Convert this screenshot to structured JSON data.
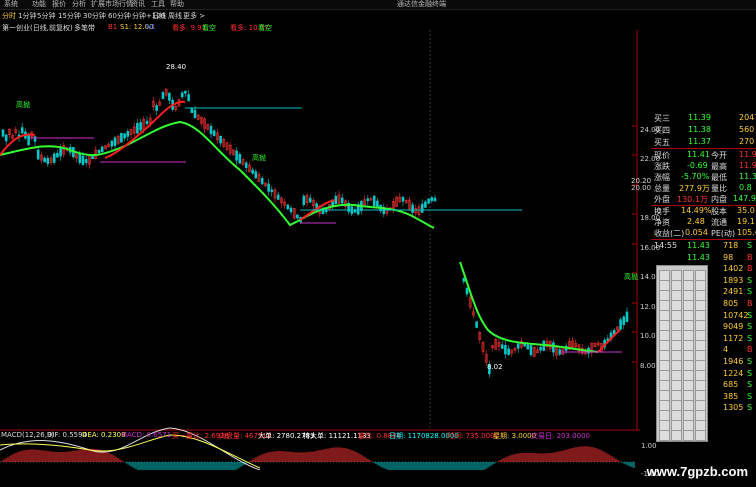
{
  "menubar": {
    "items": [
      "系统",
      "功能",
      "报价",
      "分析",
      "扩展市场行情",
      "资讯",
      "工具",
      "帮助"
    ],
    "right_title": "通达信金融终端"
  },
  "toolbar": {
    "tabs": [
      "分时",
      "1分钟",
      "5分钟",
      "15分钟",
      "30分钟",
      "60分钟",
      "分钟+120",
      "日线",
      "周线",
      "更多 >"
    ],
    "active_index": 0
  },
  "infobar": {
    "name": "第一创业(日线,前复权)",
    "indicator": "多笔带",
    "b1": "B1",
    "s1": "S1: 12.00",
    "n1": "N1",
    "sell1": "看多: 9.91",
    "sell2": "看空",
    "sell3": "看多: 10.77",
    "sell4": "看空"
  },
  "y_axis_main": [
    "24.00",
    "22.00",
    "20.00",
    "18.00",
    "16.00",
    "14.00",
    "12.00",
    "10.00",
    "8.00"
  ],
  "y_axis_extra": "20.20",
  "annotations": {
    "high": "28.40",
    "low": "8.02",
    "cross1": "高抛",
    "cross2": "高抛",
    "cross3": "高抛"
  },
  "macd": {
    "title": "MACD(12,26,9)",
    "dif": "DIF: 0.5594",
    "dea": "DEA: 0.2308",
    "macd": "MACD: 0.6571",
    "hui1": "买一量比: 2.6926",
    "hui2": "内盘量: 467913",
    "hui3": "大单: 2780.2783",
    "hui4": "特大单: 11121.1133",
    "hui5": "量比: 0.8884",
    "hui6": "日期: 1170828.0000",
    "hui7": "时间: 735.0000",
    "hui8": "星期: 3.0000",
    "hui9": "交易日: 203.0000",
    "y_top": "1.00",
    "y_bottom": "-1.00"
  },
  "panel": {
    "rows": [
      {
        "label": "买三",
        "value": "11.39",
        "vol": "2047"
      },
      {
        "label": "买四",
        "value": "11.38",
        "vol": "560"
      },
      {
        "label": "买五",
        "value": "11.37",
        "vol": "270"
      }
    ],
    "quote": [
      {
        "l1": "现价",
        "v1": "11.41",
        "l2": "今开",
        "v2": "11.9"
      },
      {
        "l1": "涨跌",
        "v1": "-0.69",
        "l2": "最高",
        "v2": "11.9"
      },
      {
        "l1": "涨幅",
        "v1": "-5.70%",
        "l2": "最低",
        "v2": "11.3"
      },
      {
        "l1": "总量",
        "v1": "277.9万",
        "l2": "量比",
        "v2": "0.8"
      },
      {
        "l1": "外盘",
        "v1": "130.1万",
        "l2": "内盘",
        "v2": "147.9"
      }
    ],
    "stats": [
      {
        "l1": "换手",
        "v1": "14.49%",
        "l2": "股本",
        "v2": "35.0"
      },
      {
        "l1": "净资",
        "v1": "2.48",
        "l2": "流通",
        "v2": "19.1"
      },
      {
        "l1": "收益(二)",
        "v1": "0.054",
        "l2": "PE(动)",
        "v2": "105.6"
      }
    ],
    "ticks": [
      {
        "t": "14:55",
        "p": "11.43",
        "v": "718",
        "s": "S"
      },
      {
        "t": "",
        "p": "11.43",
        "v": "98",
        "s": "B"
      },
      {
        "t": "",
        "p": "",
        "v": "1402",
        "s": "B"
      },
      {
        "t": "",
        "p": "",
        "v": "1893",
        "s": "S"
      },
      {
        "t": "",
        "p": "",
        "v": "2491",
        "s": "S"
      },
      {
        "t": "",
        "p": "",
        "v": "805",
        "s": "B"
      },
      {
        "t": "",
        "p": "",
        "v": "10742",
        "s": "S"
      },
      {
        "t": "",
        "p": "",
        "v": "9049",
        "s": "S"
      },
      {
        "t": "",
        "p": "",
        "v": "1172",
        "s": "S"
      },
      {
        "t": "",
        "p": "",
        "v": "4",
        "s": "B"
      },
      {
        "t": "",
        "p": "",
        "v": "1946",
        "s": "S"
      },
      {
        "t": "",
        "p": "",
        "v": "1224",
        "s": "S"
      },
      {
        "t": "",
        "p": "",
        "v": "685",
        "s": "S"
      },
      {
        "t": "",
        "p": "",
        "v": "385",
        "s": "S"
      },
      {
        "t": "",
        "p": "",
        "v": "1305",
        "s": "S"
      }
    ]
  },
  "watermark": "www.7gpzb.com",
  "colors": {
    "up": "#ff3333",
    "down": "#00ffff",
    "ma_green": "#33ff33",
    "ma_red": "#ff2020",
    "gold": "#ffcc33",
    "magenta": "#cc33cc",
    "cyan_line": "#00c0c0"
  }
}
